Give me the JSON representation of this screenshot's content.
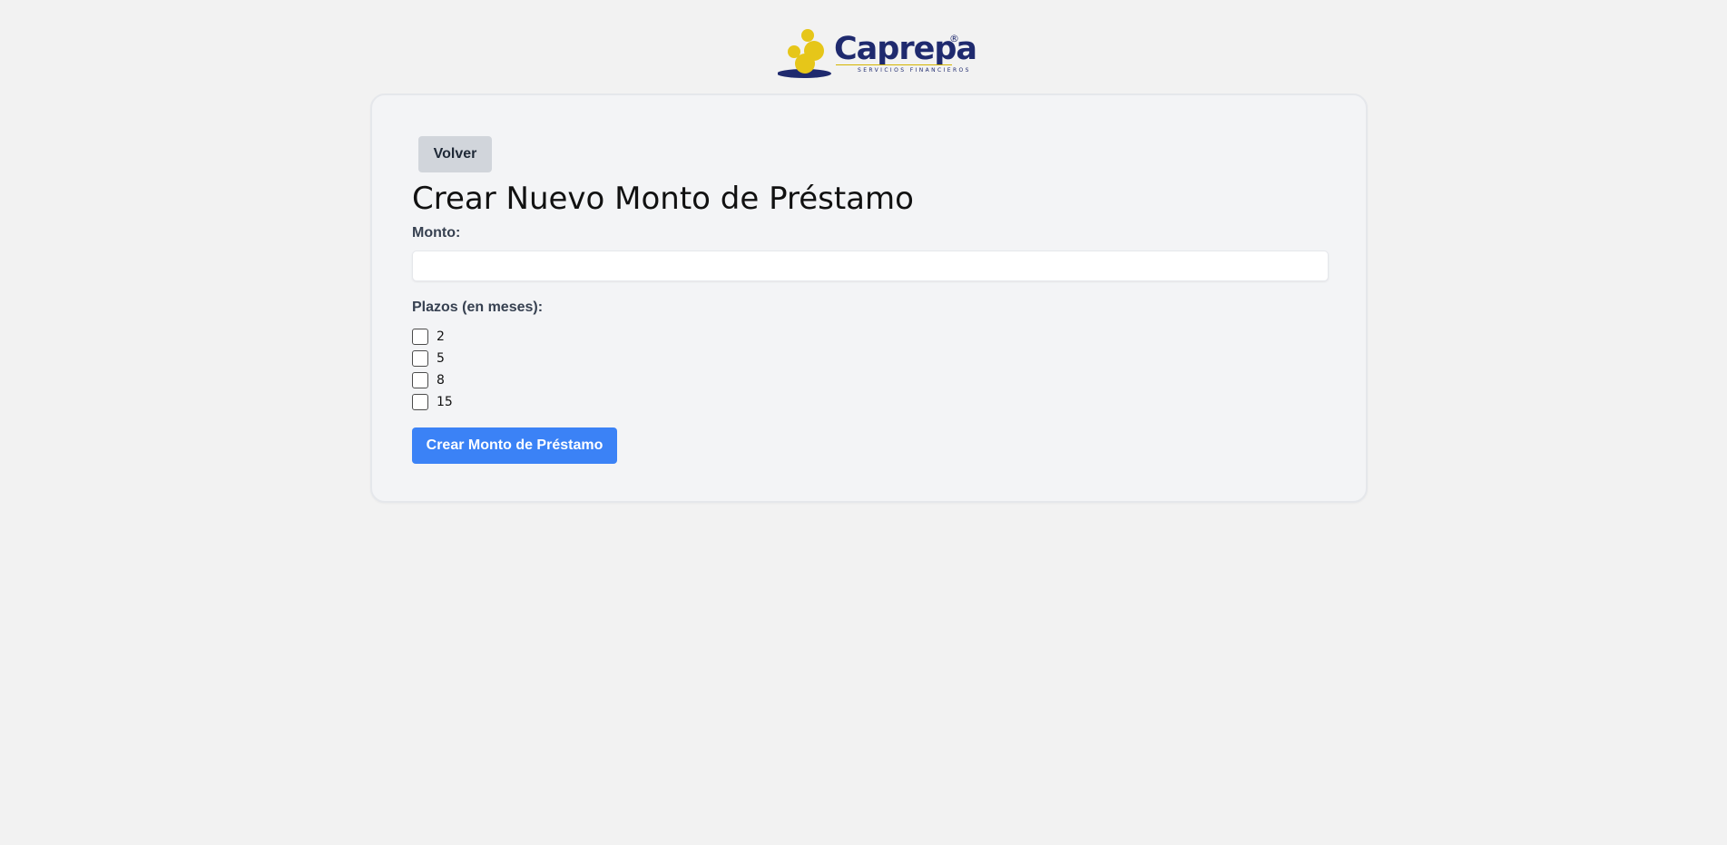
{
  "brand": {
    "name": "Caprepa",
    "registered_mark": "®",
    "tagline": "SERVICIOS FINANCIEROS",
    "colors": {
      "navy": "#1f2a6e",
      "yellow": "#e6c619"
    }
  },
  "toolbar": {
    "back_label": "Volver"
  },
  "form": {
    "title": "Crear Nuevo Monto de Préstamo",
    "amount": {
      "label": "Monto:",
      "value": "",
      "placeholder": ""
    },
    "terms": {
      "label": "Plazos (en meses):",
      "options": [
        {
          "label": "2",
          "checked": false
        },
        {
          "label": "5",
          "checked": false
        },
        {
          "label": "8",
          "checked": false
        },
        {
          "label": "15",
          "checked": false
        }
      ]
    },
    "submit_label": "Crear Monto de Préstamo",
    "colors": {
      "primary_button": "#3b82f6",
      "secondary_button": "#d1d5db"
    }
  }
}
